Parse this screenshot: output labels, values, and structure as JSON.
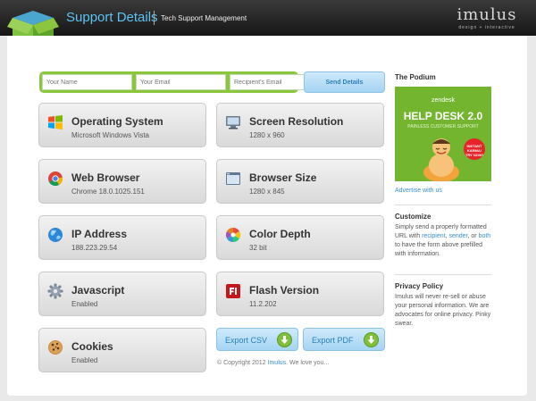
{
  "header": {
    "title": "Support Details",
    "subtitle": "Tech Support Management",
    "brand": "imulus",
    "brand_tagline": "design + interactive"
  },
  "form": {
    "name_placeholder": "Your Name",
    "email_placeholder": "Your Email",
    "recipient_placeholder": "Recipient's Email",
    "send_label": "Send Details"
  },
  "cards": [
    {
      "label": "Operating System",
      "value": "Microsoft Windows Vista",
      "icon": "windows-logo-icon"
    },
    {
      "label": "Screen Resolution",
      "value": "1280 x 960",
      "icon": "monitor-icon"
    },
    {
      "label": "Web Browser",
      "value": "Chrome 18.0.1025.151",
      "icon": "chrome-logo-icon"
    },
    {
      "label": "Browser Size",
      "value": "1280 x 845",
      "icon": "browser-window-icon"
    },
    {
      "label": "IP Address",
      "value": "188.223.29.54",
      "icon": "globe-icon"
    },
    {
      "label": "Color Depth",
      "value": "32 bit",
      "icon": "color-wheel-icon"
    },
    {
      "label": "Javascript",
      "value": "Enabled",
      "icon": "gear-icon"
    },
    {
      "label": "Flash Version",
      "value": "11.2.202",
      "icon": "flash-logo-icon"
    },
    {
      "label": "Cookies",
      "value": "Enabled",
      "icon": "cookie-icon"
    }
  ],
  "export": {
    "csv_label": "Export CSV",
    "pdf_label": "Export PDF"
  },
  "footer": {
    "copyright_prefix": "© Copyright 2012",
    "copyright_link": "Imulus",
    "copyright_suffix": ". We love you..."
  },
  "sidebar": {
    "podium_heading": "The Podium",
    "ad_brand": "zendesk",
    "ad_headline": "HELP DESK 2.0",
    "ad_tagline": "PAINLESS CUSTOMER SUPPORT",
    "ad_badge": "INSTANT KARMA! TRY NOW!",
    "advertise_link": "Advertise with us",
    "customize_heading": "Customize",
    "customize_text_1": "Simply send a properly formatted URL with",
    "customize_link_recipient": "recipient",
    "customize_link_sender": "sender",
    "customize_or": ", or",
    "customize_link_both": "both",
    "customize_text_2": "to have the form above prefilled with information.",
    "privacy_heading": "Privacy Policy",
    "privacy_text": "Imulus will never re-sell or abuse your personal information. We are advocates for online privacy. Pinky swear."
  },
  "colors": {
    "accent_blue": "#5cc3f2",
    "link_blue": "#3a8fcf",
    "form_green": "#8cc63f"
  }
}
